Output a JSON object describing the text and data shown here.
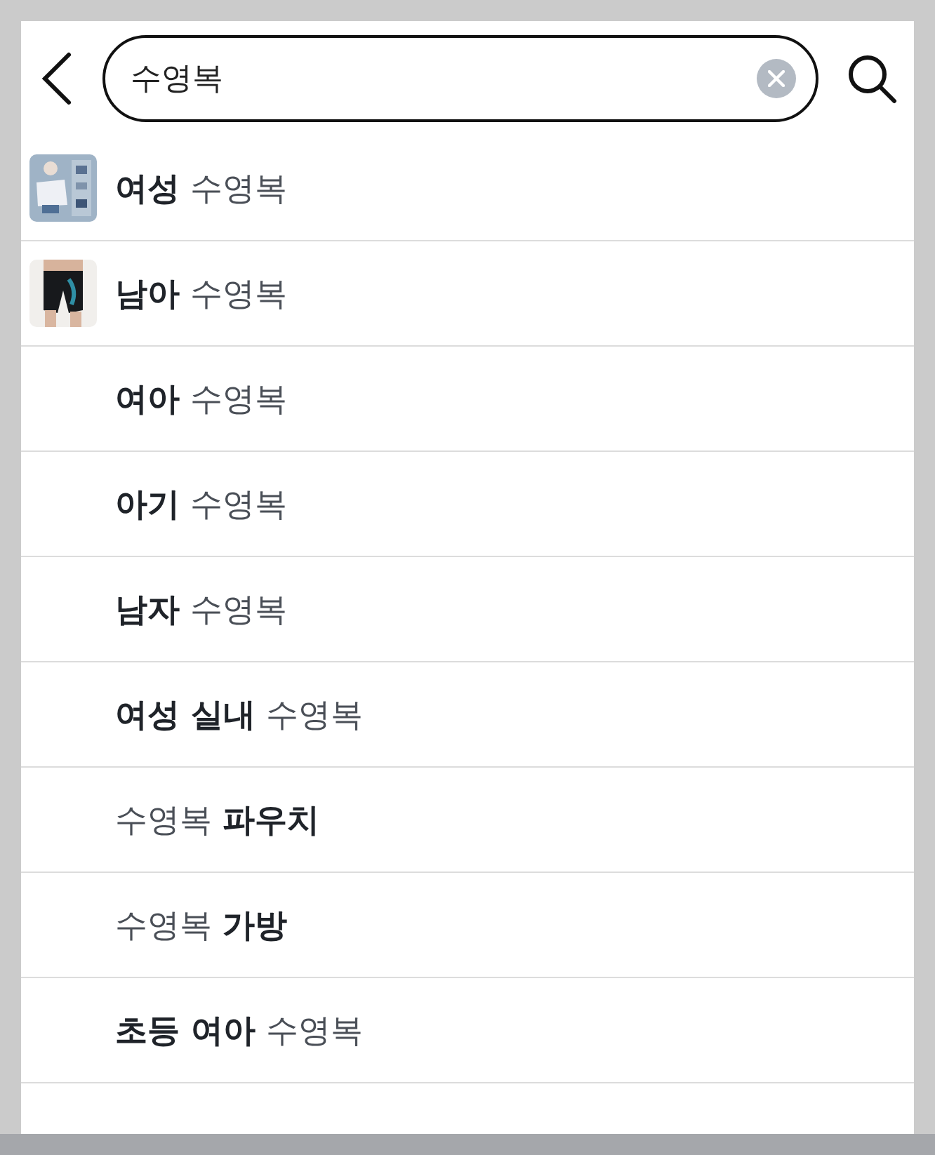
{
  "search": {
    "value": "수영복"
  },
  "suggestions": [
    {
      "text": "**여성** 수영복"
    },
    {
      "text": "**남아** 수영복"
    },
    {
      "text": "**여아** 수영복"
    },
    {
      "text": "**아기** 수영복"
    },
    {
      "text": "**남자** 수영복"
    },
    {
      "text": "**여성 실내** 수영복"
    },
    {
      "text": "수영복 **파우치**"
    },
    {
      "text": "수영복 **가방**"
    },
    {
      "text": "**초등 여아** 수영복"
    }
  ]
}
